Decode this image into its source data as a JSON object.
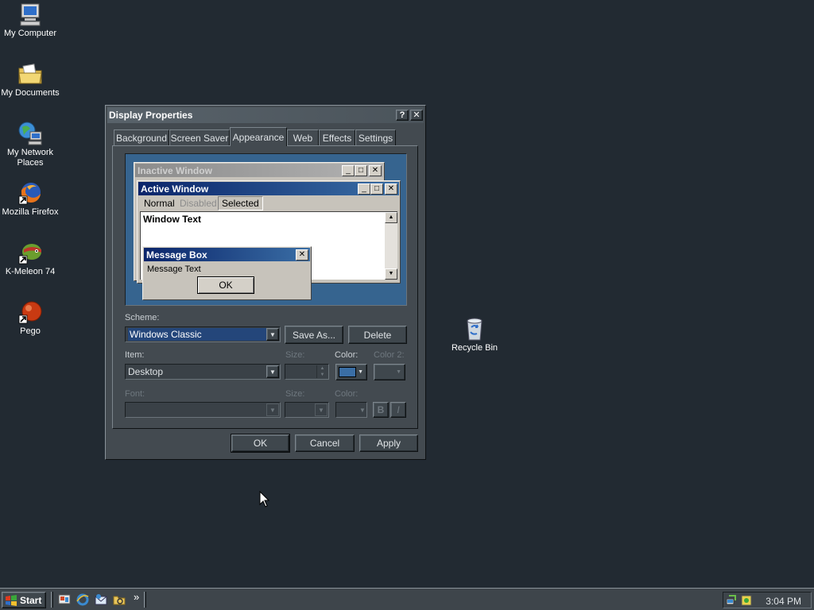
{
  "desktop": {
    "icons": [
      {
        "label": "My Computer",
        "icon": "my-computer-icon"
      },
      {
        "label": "My Documents",
        "icon": "my-documents-icon"
      },
      {
        "label_line1": "My Network",
        "label_line2": "Places",
        "icon": "network-places-icon"
      },
      {
        "label": "Mozilla Firefox",
        "icon": "firefox-icon"
      },
      {
        "label": "K-Meleon 74",
        "icon": "k-meleon-icon"
      },
      {
        "label": "Pego",
        "icon": "pego-icon"
      },
      {
        "label": "Recycle Bin",
        "icon": "recycle-bin-icon"
      }
    ]
  },
  "dialog": {
    "title": "Display Properties",
    "help_glyph": "?",
    "close_glyph": "✕",
    "tabs": [
      "Background",
      "Screen Saver",
      "Appearance",
      "Web",
      "Effects",
      "Settings"
    ],
    "active_tab": "Appearance",
    "preview": {
      "inactive_title": "Inactive Window",
      "active_title": "Active Window",
      "menu": {
        "normal": "Normal",
        "disabled": "Disabled",
        "selected": "Selected"
      },
      "window_text": "Window Text",
      "message_box_title": "Message Box",
      "message_text": "Message Text",
      "ok": "OK"
    },
    "scheme_label": "Scheme:",
    "scheme_value": "Windows Classic",
    "save_as": "Save As...",
    "delete": "Delete",
    "item_label": "Item:",
    "item_value": "Desktop",
    "size_label": "Size:",
    "color_label": "Color:",
    "color2_label": "Color 2:",
    "font_label": "Font:",
    "font_size_label": "Size:",
    "font_color_label": "Color:",
    "bold_glyph": "B",
    "italic_glyph": "I",
    "color_swatch": "#3a6ea5",
    "ok": "OK",
    "cancel": "Cancel",
    "apply": "Apply"
  },
  "taskbar": {
    "start": "Start",
    "quick_launch": [
      "show-desktop-icon",
      "ie-icon",
      "outlook-icon",
      "explorer-icon"
    ],
    "chevron": "»",
    "clock": "3:04 PM"
  }
}
